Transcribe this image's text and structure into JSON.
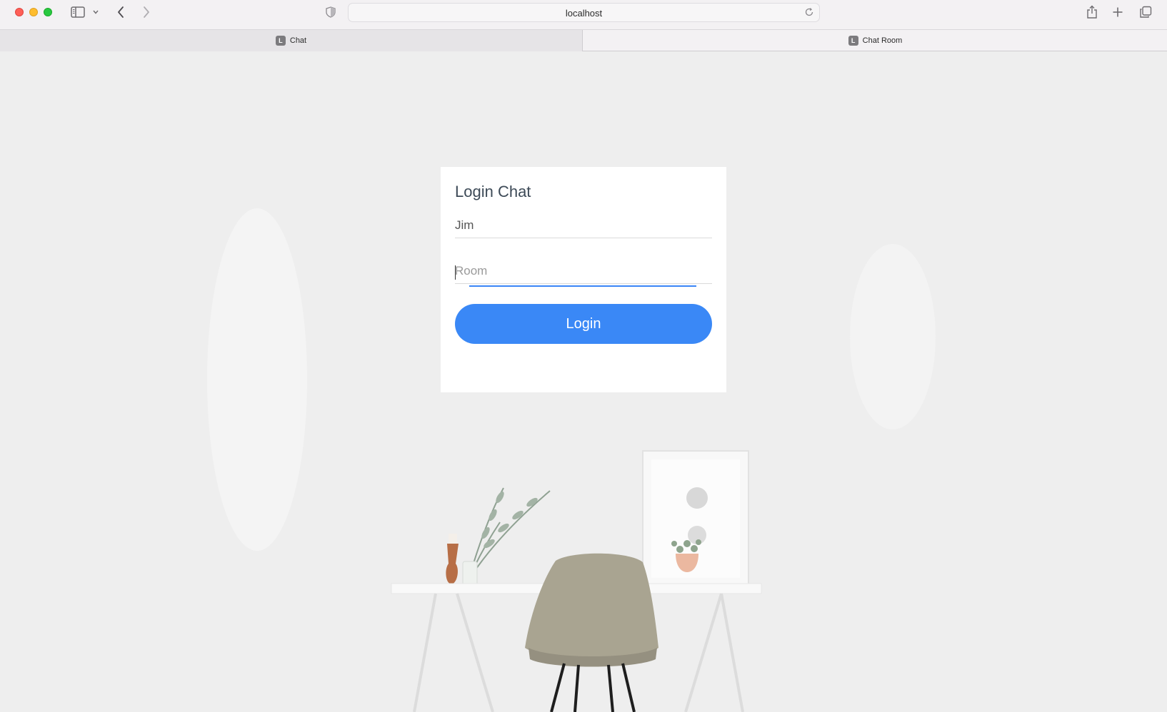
{
  "browser": {
    "url": "localhost",
    "tabs": [
      {
        "label": "Chat",
        "favicon": "L",
        "active": true
      },
      {
        "label": "Chat Room",
        "favicon": "L",
        "active": false
      }
    ]
  },
  "login": {
    "title": "Login Chat",
    "name_value": "Jim",
    "room_placeholder": "Room",
    "button_label": "Login"
  },
  "colors": {
    "accent": "#3a88f6",
    "page_bg": "#eeeeee"
  }
}
